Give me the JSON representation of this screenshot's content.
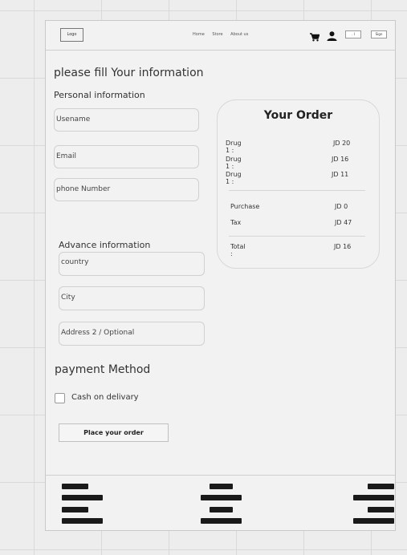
{
  "header": {
    "logo": "Logo",
    "nav": [
      "Home",
      "Store",
      "About us"
    ],
    "icons": [
      "cart-icon",
      "user-icon"
    ],
    "button_1": ". I",
    "button_2": "Sign"
  },
  "form": {
    "title": "please fill Your information",
    "personal_heading": "Personal information",
    "username_placeholder": "Usename",
    "email_placeholder": "Email",
    "phone_placeholder": "phone Number",
    "advance_heading": "Advance information",
    "country_placeholder": "country",
    "city_placeholder": "City",
    "address_placeholder": "Address 2 / Optional",
    "payment_heading": "payment Method",
    "payment_option": "Cash on delivary",
    "place_order": "Place your order"
  },
  "order": {
    "title": "Your Order",
    "items": [
      {
        "label": "Drug 1 :",
        "price": "JD 20"
      },
      {
        "label": "Drug 1 :",
        "price": "JD 16"
      },
      {
        "label": "Drug 1 :",
        "price": "JD 11"
      }
    ],
    "purchase_label": "Purchase",
    "purchase_value": "JD 0",
    "tax_label": "Tax",
    "tax_value": "JD 47",
    "total_label": "Total :",
    "total_value": "JD 16"
  }
}
